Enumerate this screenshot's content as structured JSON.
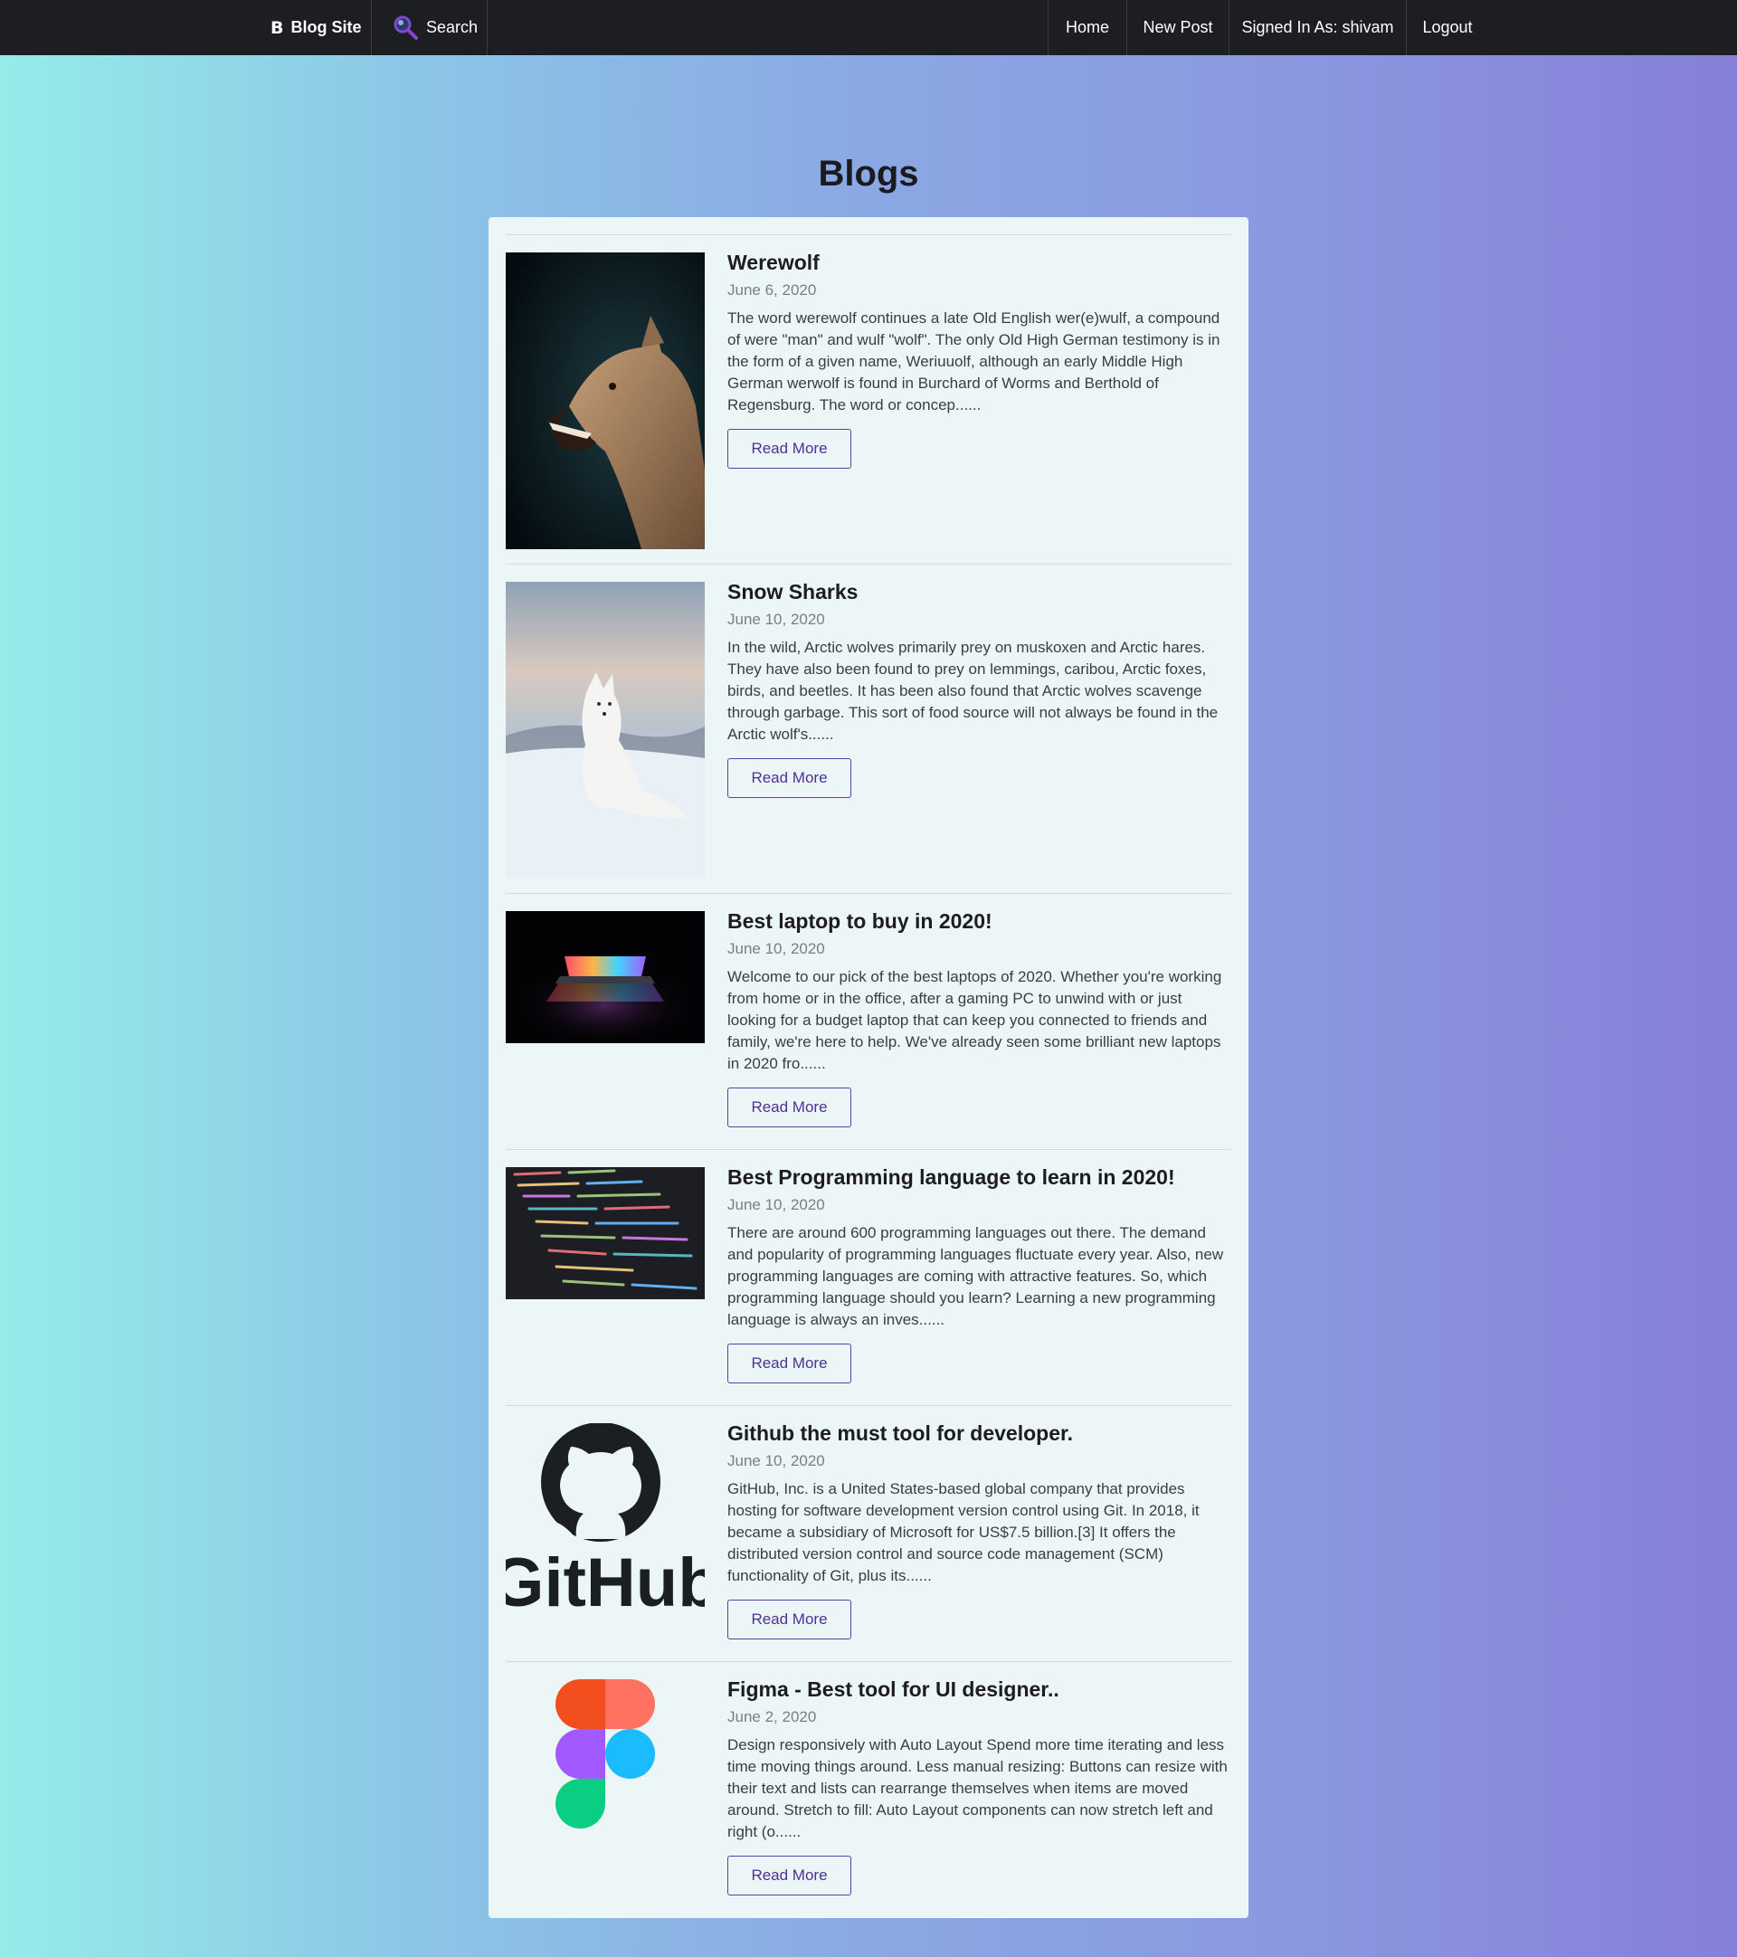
{
  "nav": {
    "brand_icon": "B",
    "brand_label": "Blog Site",
    "search_label": "Search",
    "links": [
      "Home",
      "New Post",
      "Signed In As: shivam",
      "Logout"
    ]
  },
  "page": {
    "title": "Blogs"
  },
  "posts": [
    {
      "title": "Werewolf",
      "date": "June 6, 2020",
      "excerpt": "The word werewolf continues a late Old English wer(e)wulf, a compound of were \"man\" and wulf \"wolf\". The only Old High German testimony is in the form of a given name, Weriuuolf, although an early Middle High German werwolf is found in Burchard of Worms and Berthold of Regensburg. The word or concep......",
      "button": "Read More",
      "image": "wolf-snarling-photo"
    },
    {
      "title": "Snow Sharks",
      "date": "June 10, 2020",
      "excerpt": "In the wild, Arctic wolves primarily prey on muskoxen and Arctic hares. They have also been found to prey on lemmings, caribou, Arctic foxes, birds, and beetles. It has been also found that Arctic wolves scavenge through garbage. This sort of food source will not always be found in the Arctic wolf's......",
      "button": "Read More",
      "image": "white-wolf-snow-photo"
    },
    {
      "title": "Best laptop to buy in 2020!",
      "date": "June 10, 2020",
      "excerpt": "Welcome to our pick of the best laptops of 2020. Whether you're working from home or in the office, after a gaming PC to unwind with or just looking for a budget laptop that can keep you connected to friends and family, we're here to help. We've already seen some brilliant new laptops in 2020 fro......",
      "button": "Read More",
      "image": "laptop-glow-photo"
    },
    {
      "title": "Best Programming language to learn in 2020!",
      "date": "June 10, 2020",
      "excerpt": "There are around 600 programming languages out there. The demand and popularity of programming languages fluctuate every year. Also, new programming languages are coming with attractive features. So, which programming language should you learn? Learning a new programming language is always an inves......",
      "button": "Read More",
      "image": "code-screen-photo"
    },
    {
      "title": "Github the must tool for developer.",
      "date": "June 10, 2020",
      "excerpt": "GitHub, Inc. is a United States-based global company that provides hosting for software development version control using Git. In 2018, it became a subsidiary of Microsoft for US$7.5 billion.[3] It offers the distributed version control and source code management (SCM) functionality of Git, plus its......",
      "button": "Read More",
      "image": "github-logo",
      "logo_text": "GitHub"
    },
    {
      "title": "Figma - Best tool for UI designer..",
      "date": "June 2, 2020",
      "excerpt": "Design responsively with Auto Layout Spend more time iterating and less time moving things around. Less manual resizing: Buttons can resize with their text and lists can rearrange themselves when items are moved around. Stretch to fill: Auto Layout components can now stretch left and right (o......",
      "button": "Read More",
      "image": "figma-logo"
    }
  ],
  "colors": {
    "navbar": "#1c1e22",
    "card": "#edf6f7",
    "button_accent": "#5b3fa6",
    "gradient_left": "#94ece9",
    "gradient_right": "#857fd8"
  }
}
